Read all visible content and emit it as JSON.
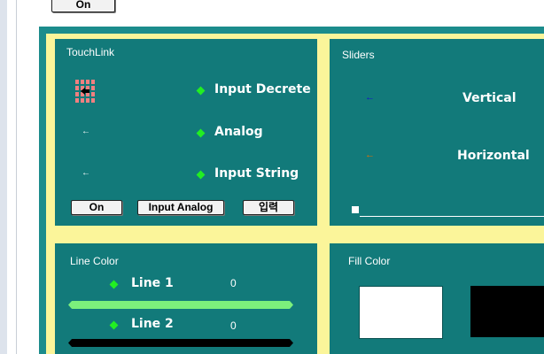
{
  "top_button_label": "On",
  "touchlink": {
    "title": "TouchLink",
    "rows": [
      {
        "label": "Input Decrete"
      },
      {
        "label": "Analog"
      },
      {
        "label": "Input String"
      }
    ],
    "buttons": {
      "on": "On",
      "input_analog": "Input Analog",
      "input_kr": "입력"
    }
  },
  "sliders": {
    "title": "Sliders",
    "vertical_label": "Vertical",
    "horizontal_label": "Horizontal"
  },
  "line_color": {
    "title": "Line Color",
    "lines": [
      {
        "label": "Line 1",
        "value": "0",
        "color": "#7cf07c"
      },
      {
        "label": "Line 2",
        "value": "0",
        "color": "#000000"
      }
    ]
  },
  "fill_color": {
    "title": "Fill Color",
    "swatches": [
      "#ffffff",
      "#000000"
    ]
  },
  "colors": {
    "teal": "#127a7a",
    "border": "#1c8c8c",
    "frame": "#fbf59a",
    "indicator": "#22ee22"
  },
  "icons": [
    "touch-icon",
    "left-arrow-icon",
    "diamond-indicator-icon"
  ]
}
